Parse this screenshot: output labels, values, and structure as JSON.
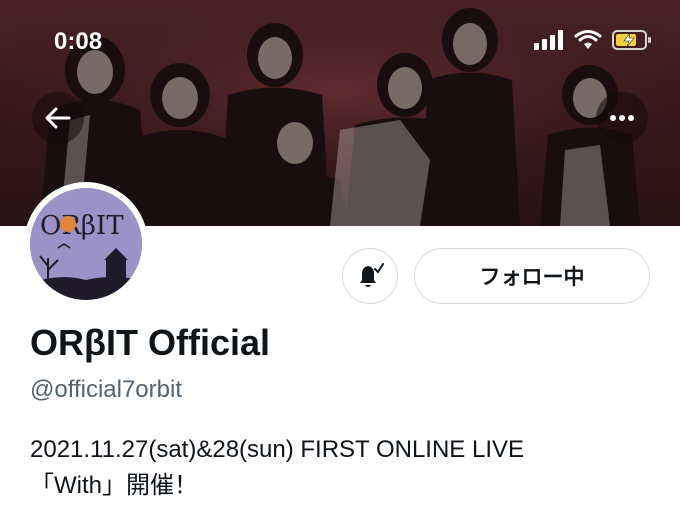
{
  "status_bar": {
    "time": "0:08",
    "icons": [
      "signal-icon",
      "wifi-icon",
      "battery-charging-icon"
    ]
  },
  "header": {
    "back_icon": "arrow-left-icon",
    "more_icon": "ellipsis-icon",
    "banner": "group-photo"
  },
  "profile": {
    "avatar_logo": "ORβIT",
    "display_name": "ORβIT Official",
    "handle": "@official7orbit",
    "bio": [
      "2021.11.27(sat)&28(sun) FIRST ONLINE LIVE",
      "「With」開催！"
    ]
  },
  "actions": {
    "notification_icon": "bell-check-icon",
    "follow_label": "フォロー中"
  },
  "colors": {
    "text_primary": "#0f1419",
    "text_secondary": "#536471",
    "button_border": "#cfd9de"
  }
}
